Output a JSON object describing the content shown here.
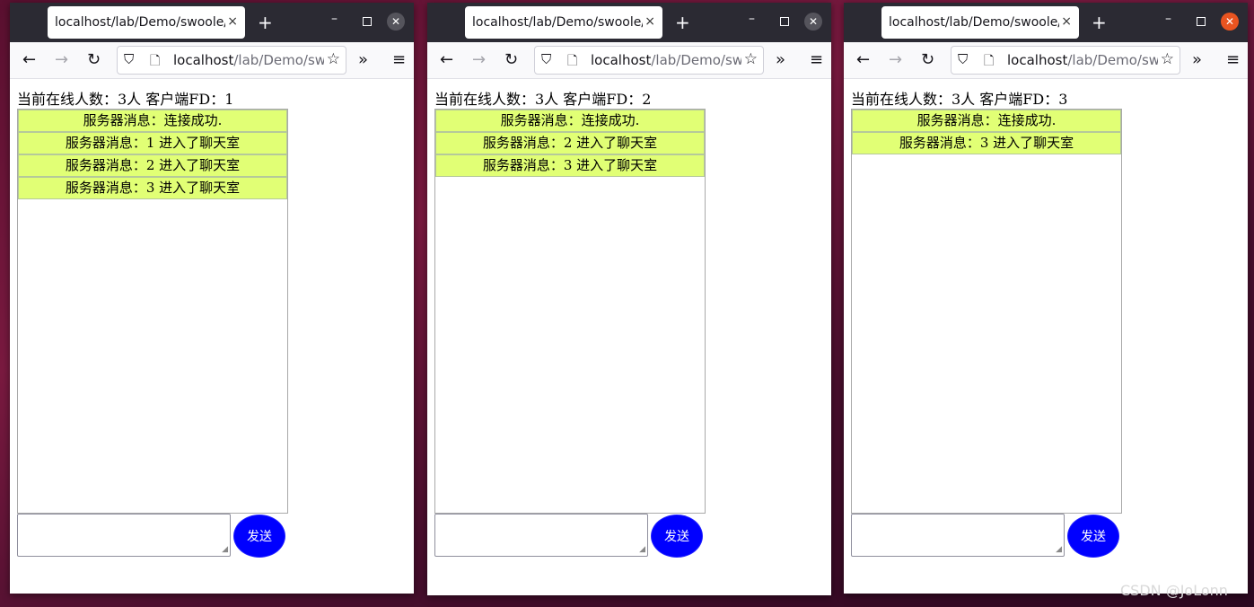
{
  "browser": {
    "tab_title": "localhost/lab/Demo/swoole/",
    "url_host": "localhost",
    "url_path": "/lab/Demo/sw",
    "tab_close_glyph": "×",
    "new_tab_glyph": "+",
    "minimize_glyph": "–",
    "close_glyph": "✕"
  },
  "windows": [
    {
      "online_text": "当前在线人数：3人   客户端FD：1",
      "messages": [
        "服务器消息：连接成功.",
        "服务器消息：1 进入了聊天室",
        "服务器消息：2 进入了聊天室",
        "服务器消息：3 进入了聊天室"
      ],
      "send_label": "发送",
      "active": false
    },
    {
      "online_text": "当前在线人数：3人   客户端FD：2",
      "messages": [
        "服务器消息：连接成功.",
        "服务器消息：2 进入了聊天室",
        "服务器消息：3 进入了聊天室"
      ],
      "send_label": "发送",
      "active": false
    },
    {
      "online_text": "当前在线人数：3人   客户端FD：3",
      "messages": [
        "服务器消息：连接成功.",
        "服务器消息：3 进入了聊天室"
      ],
      "send_label": "发送",
      "active": true
    }
  ],
  "colors": {
    "message_bg": "#e1ff75",
    "send_button": "#0000ff",
    "active_close": "#e95420"
  },
  "watermark": "CSDN @JoLonn"
}
